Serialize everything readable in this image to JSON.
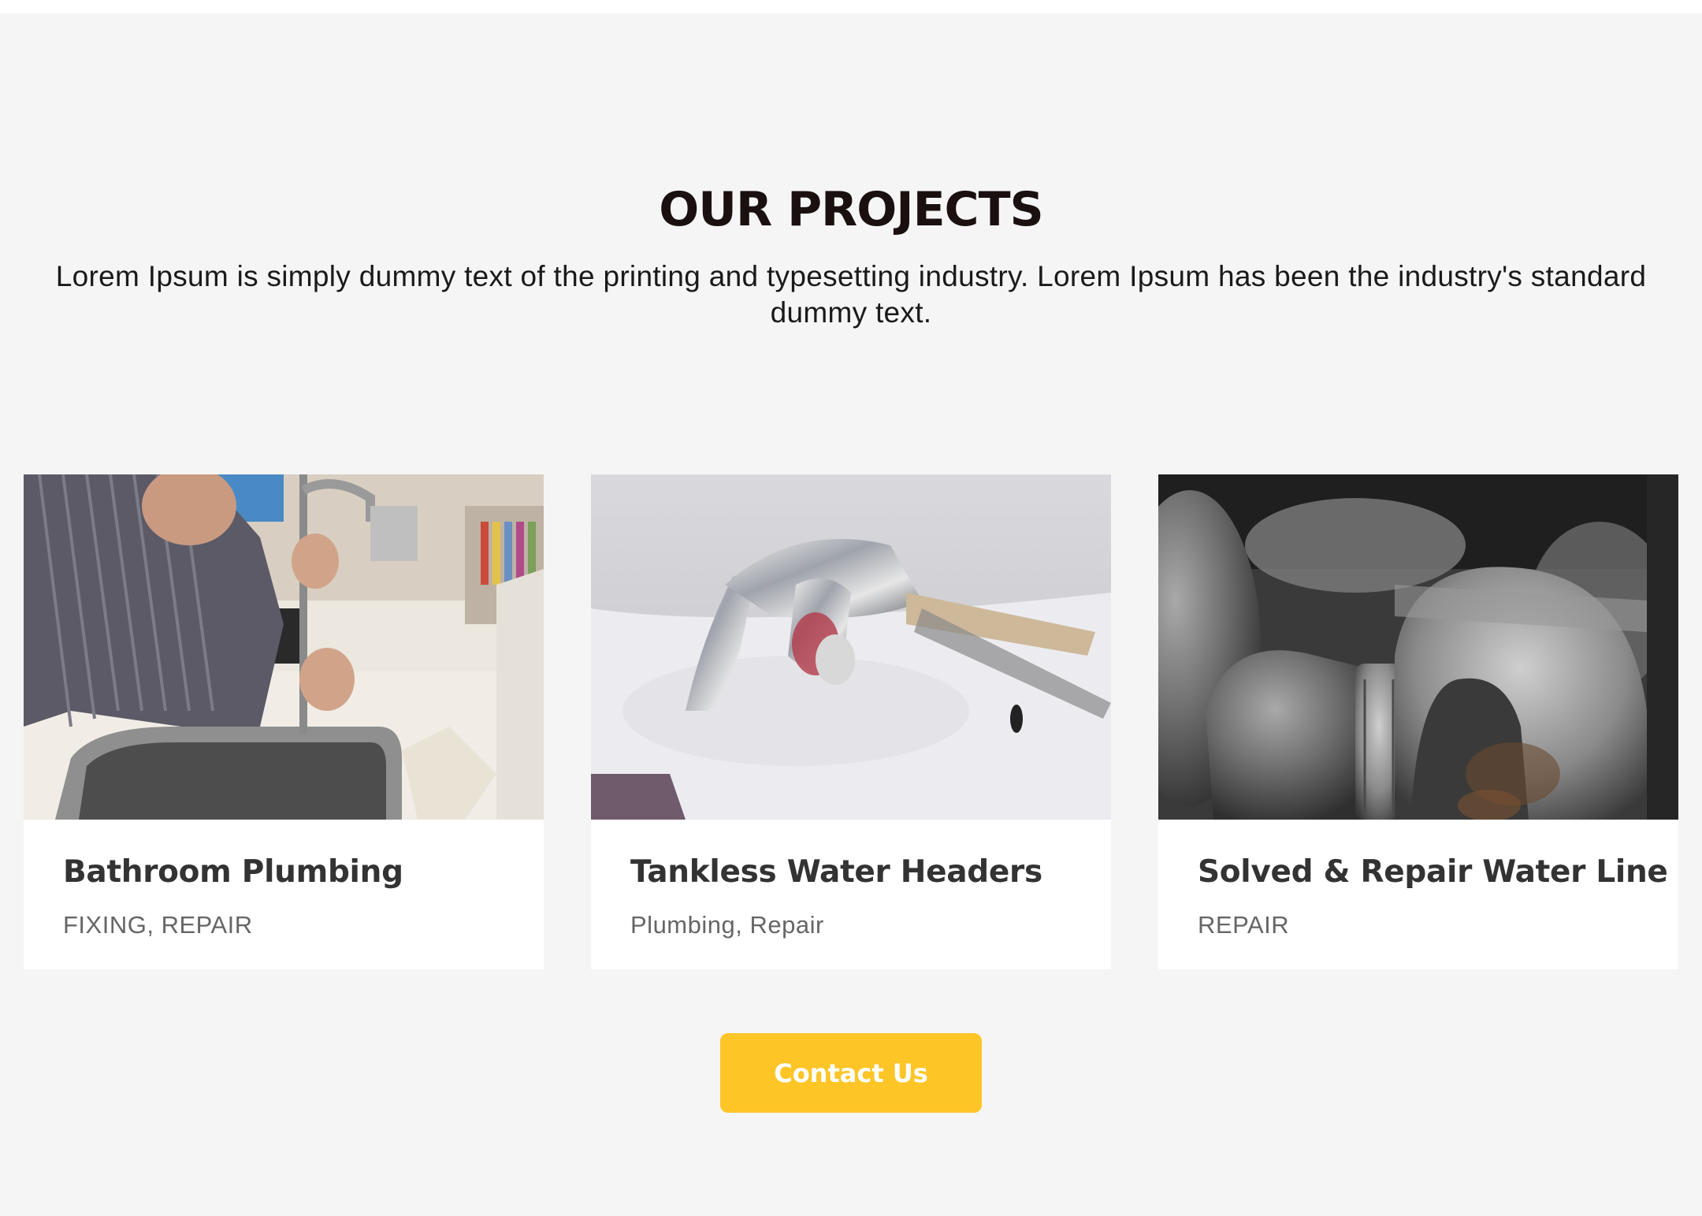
{
  "section": {
    "title": "OUR PROJECTS",
    "description": "Lorem Ipsum is simply dummy text of the printing and typesetting industry. Lorem Ipsum has been the industry's standard dummy text."
  },
  "projects": [
    {
      "title": "Bathroom Plumbing",
      "tags": "FIXING, REPAIR",
      "image": "plumber-fixing-kitchen-faucet"
    },
    {
      "title": "Tankless Water Headers",
      "tags": "Plumbing, Repair",
      "image": "chrome-faucet-on-sink"
    },
    {
      "title": "Solved & Repair Water Line",
      "tags": "REPAIR",
      "image": "iron-pipe-fittings"
    }
  ],
  "cta": {
    "label": "Contact Us"
  },
  "colors": {
    "accent": "#fec527",
    "background": "#f5f5f5",
    "heading": "#1b1010",
    "card_title": "#333333",
    "card_tags": "#666666"
  }
}
